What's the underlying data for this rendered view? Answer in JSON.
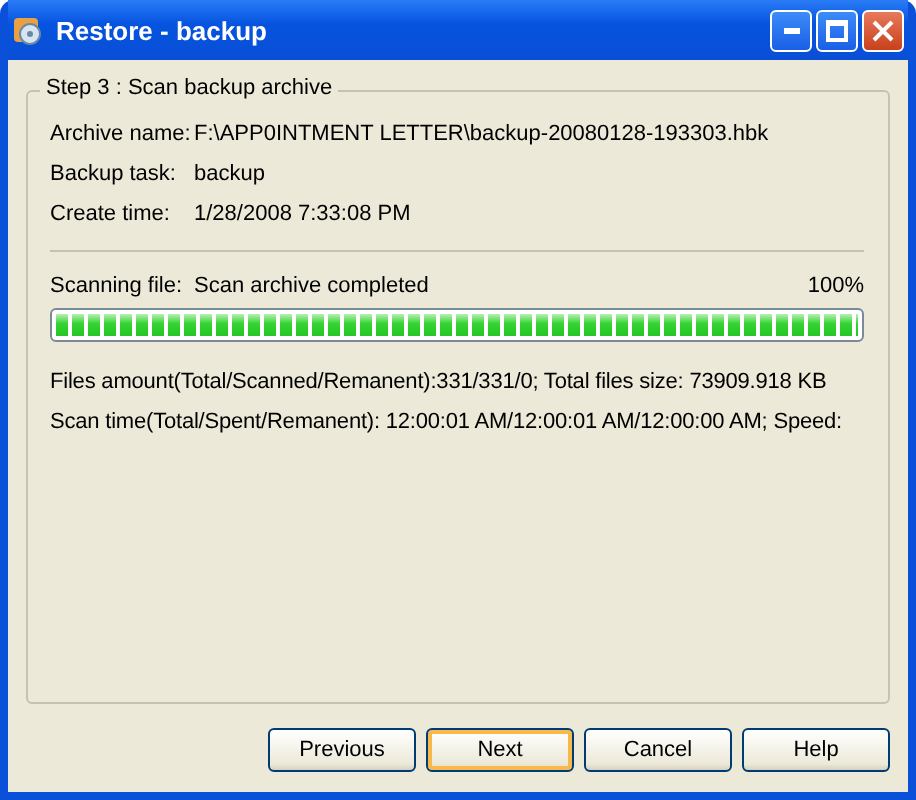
{
  "window": {
    "title": "Restore - backup"
  },
  "group": {
    "title": "Step 3 : Scan backup archive"
  },
  "info": [
    {
      "label": "Archive name:",
      "value": "F:\\APP0INTMENT LETTER\\backup-20080128-193303.hbk"
    },
    {
      "label": "Backup task:",
      "value": "backup"
    },
    {
      "label": "Create time:",
      "value": "1/28/2008 7:33:08 PM"
    }
  ],
  "scan": {
    "label": "Scanning file:",
    "value": "Scan archive completed",
    "percent": "100%",
    "level": 1
  },
  "stats": [
    "Files amount(Total/Scanned/Remanent):331/331/0; Total files size: 73909.918 KB",
    "Scan time(Total/Spent/Remanent): 12:00:01 AM/12:00:01 AM/12:00:00 AM; Speed:"
  ],
  "buttons": [
    {
      "label": "Previous",
      "selected": false
    },
    {
      "label": "Next",
      "selected": true
    },
    {
      "label": "Cancel",
      "selected": false
    },
    {
      "label": "Help",
      "selected": false
    }
  ]
}
